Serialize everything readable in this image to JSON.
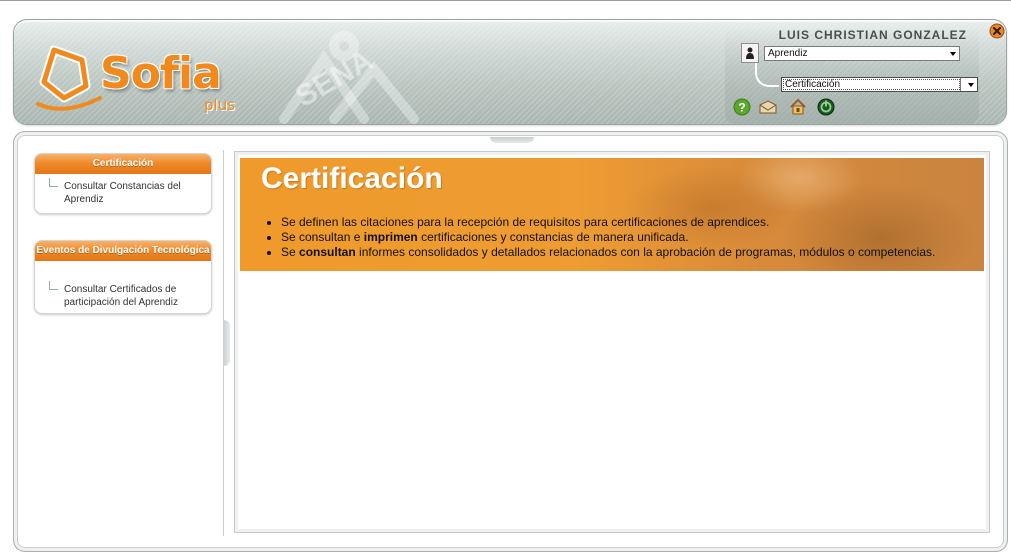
{
  "header": {
    "logo_text": "Sofia",
    "logo_sub": "plus",
    "watermark": "SENA",
    "user_name": "LUIS CHRISTIAN GONZALEZ",
    "role_select": {
      "selected": "Aprendiz"
    },
    "module_select": {
      "selected": "Certificación"
    },
    "tools": [
      "help-icon",
      "mail-icon",
      "lock-icon",
      "exit-icon"
    ],
    "accent_color": "#f08a1e"
  },
  "menu": {
    "sections": [
      {
        "title": "Certificación",
        "items": [
          "Consultar Constancias del Aprendiz"
        ]
      },
      {
        "title": "Eventos de Divulgación Tecnológica",
        "items": [
          "Consultar Certificados de participación del Aprendiz"
        ]
      }
    ]
  },
  "content": {
    "title": "Certificación",
    "bullets": [
      {
        "before": "Se definen las citaciones para la recepción de requisitos para certificaciones de aprendices.",
        "bold": "",
        "after": ""
      },
      {
        "before": "Se consultan e ",
        "bold": "imprimen",
        "after": " certificaciones y constancias de manera unificada."
      },
      {
        "before": "Se ",
        "bold": "consultan",
        "after": " informes consolidados y detallados relacionados con la aprobación de programas, módulos o competencias."
      }
    ]
  }
}
